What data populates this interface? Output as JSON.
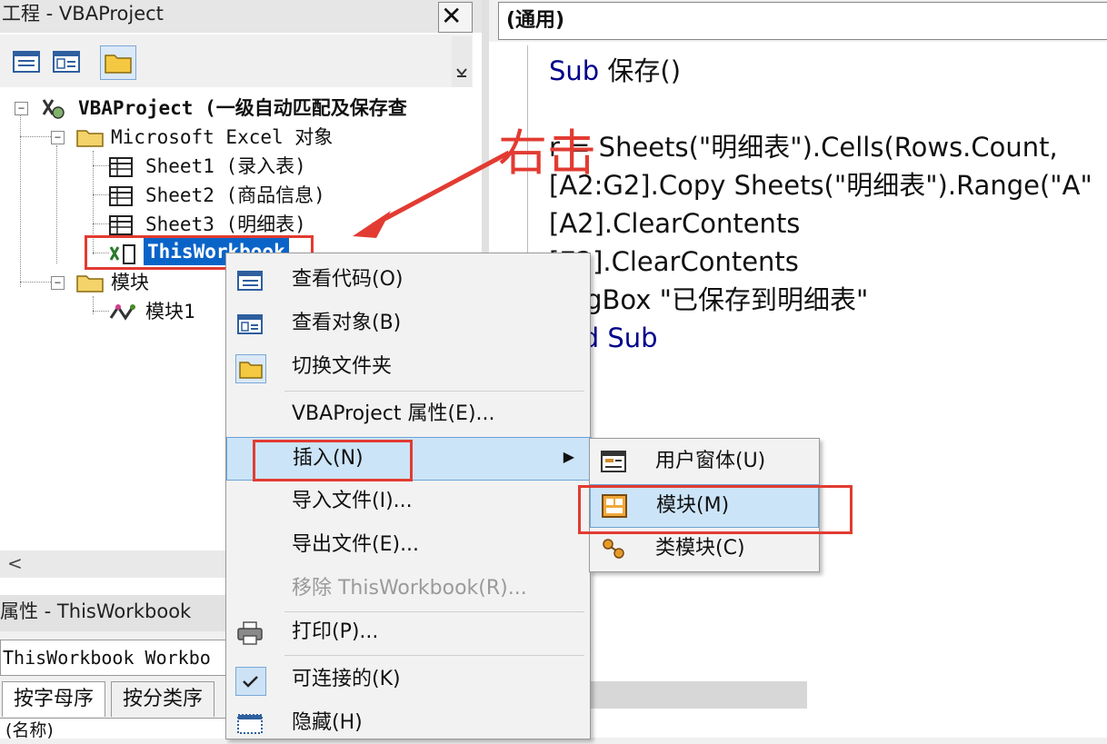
{
  "project_panel": {
    "title": "工程 - VBAProject",
    "close_label": "✕",
    "tree": {
      "root": "VBAProject (一级自动匹配及保存查",
      "excel_objects": "Microsoft Excel 对象",
      "sheets": [
        "Sheet1 (录入表)",
        "Sheet2 (商品信息)",
        "Sheet3 (明细表)"
      ],
      "this_workbook": "ThisWorkbook",
      "modules_folder": "模块",
      "module1": "模块1"
    },
    "hscroll_arrow": "<"
  },
  "properties_panel": {
    "title": "属性 - ThisWorkbook",
    "object_value": "ThisWorkbook Workbo",
    "tabs": [
      "按字母序",
      "按分类序"
    ],
    "first_row": "(名称)"
  },
  "code_window": {
    "object_combo": "(通用)",
    "lines": [
      {
        "kw": "Sub",
        "text": " 保存()"
      },
      {
        "text": "r   = Sheets(\"明细表\").Cells(Rows.Count,"
      },
      {
        "text": "[A2:G2].Copy Sheets(\"明细表\").Range(\"A\""
      },
      {
        "text": "[A2].ClearContents"
      },
      {
        "text": "[E2].ClearContents"
      },
      {
        "text": "MsgBox \"已保存到明细表\""
      },
      {
        "kw": "End Sub",
        "text": ""
      }
    ]
  },
  "annotation": "右击",
  "context_menu": {
    "items": [
      {
        "label": "查看代码(O)",
        "icon": "view-code-icon"
      },
      {
        "label": "查看对象(B)",
        "icon": "view-object-icon"
      },
      {
        "label": "切换文件夹",
        "icon": "folder-icon"
      },
      {
        "label": "VBAProject 属性(E)...",
        "icon": ""
      },
      {
        "label": "插入(N)",
        "icon": "",
        "arrow": "▶"
      },
      {
        "label": "导入文件(I)...",
        "icon": ""
      },
      {
        "label": "导出文件(E)...",
        "icon": ""
      },
      {
        "label": "移除 ThisWorkbook(R)...",
        "icon": ""
      },
      {
        "label": "打印(P)...",
        "icon": "printer-icon"
      },
      {
        "label": "可连接的(K)",
        "icon": "check-icon"
      },
      {
        "label": "隐藏(H)",
        "icon": "hide-icon"
      }
    ]
  },
  "submenu": {
    "items": [
      {
        "label": "用户窗体(U)",
        "icon": "userform-icon"
      },
      {
        "label": "模块(M)",
        "icon": "module-icon"
      },
      {
        "label": "类模块(C)",
        "icon": "class-module-icon"
      }
    ]
  }
}
